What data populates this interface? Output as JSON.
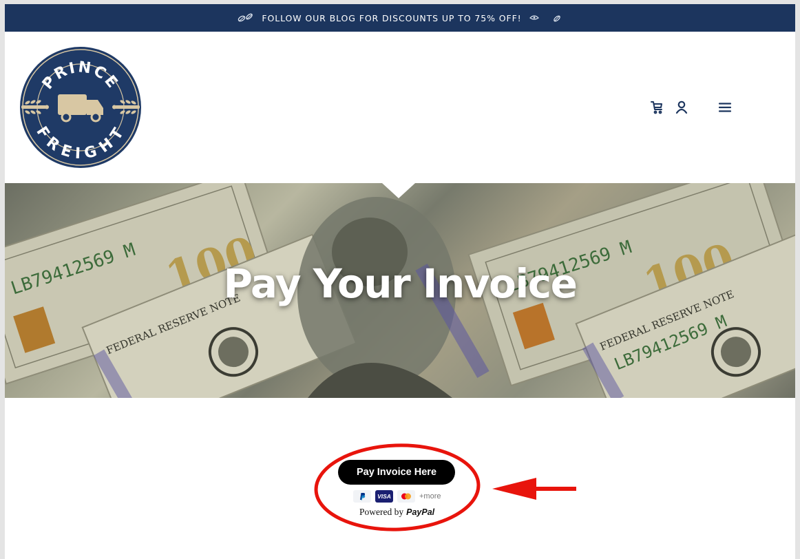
{
  "announcement": {
    "text": "FOLLOW OUR BLOG FOR DISCOUNTS UP TO 75% OFF!"
  },
  "logo": {
    "top_text": "PRINCE",
    "bottom_text": "FREIGHT"
  },
  "header": {
    "icons": [
      "cart-icon",
      "account-icon",
      "menu-icon"
    ]
  },
  "hero": {
    "title": "Pay Your Invoice",
    "bill_serial": "LB79412569 M",
    "bill_denomination": "100",
    "bill_small_text": "FEDERAL RESERVE NOTE"
  },
  "payment": {
    "button_label": "Pay Invoice Here",
    "card_visa": "VISA",
    "more_label": "+more",
    "powered_by": "Powered by",
    "provider": "PayPal"
  },
  "colors": {
    "announcement_bg": "#1c355e",
    "brand_navy": "#1f3a66",
    "brand_tan": "#d8c7a3",
    "button_bg": "#000000",
    "annotation_red": "#e8140c"
  }
}
